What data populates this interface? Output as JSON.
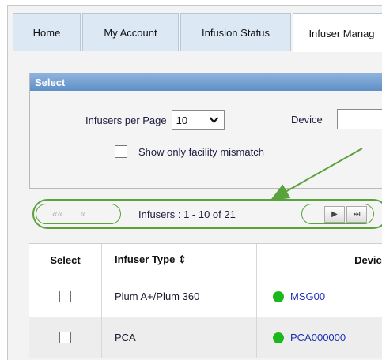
{
  "tabs": [
    {
      "label": "Home"
    },
    {
      "label": "My Account"
    },
    {
      "label": "Infusion Status"
    },
    {
      "label": "Infuser Manag"
    }
  ],
  "select_panel": {
    "title": "Select",
    "per_page_label": "Infusers per Page",
    "per_page_value": "10",
    "device_label": "Device",
    "device_value": "",
    "mismatch_label": "Show  only facility mismatch",
    "mismatch_checked": false
  },
  "pager": {
    "first_glyph": "««",
    "prev_glyph": "«",
    "info": "Infusers : 1 - 10 of 21",
    "next_glyph": "▶",
    "last_glyph": "⏭"
  },
  "table": {
    "headers": {
      "select": "Select",
      "type": "Infuser Type ⇕",
      "device": "Device"
    },
    "rows": [
      {
        "type": "Plum A+/Plum 360",
        "device": "MSG00",
        "status_color": "#1bb81b"
      },
      {
        "type": "PCA",
        "device": "PCA000000",
        "status_color": "#1bb81b"
      }
    ]
  },
  "colors": {
    "tab_bg": "#dde8f5",
    "panel_header": "#5f8fc7",
    "annotation": "#5aa33c",
    "link": "#1a2fb4"
  }
}
